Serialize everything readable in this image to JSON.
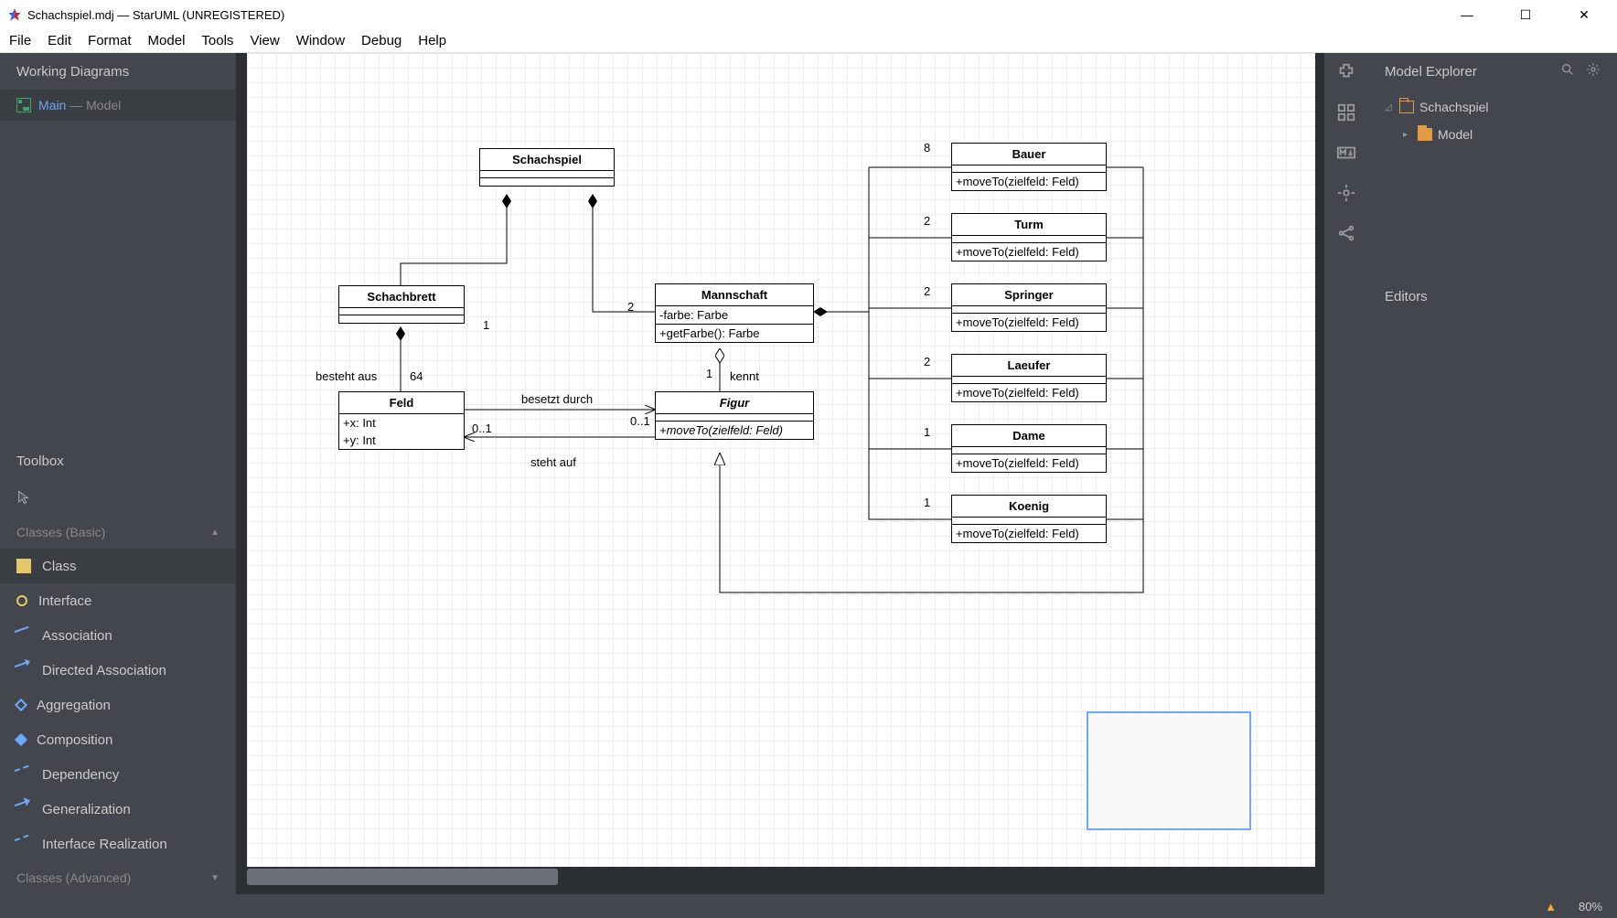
{
  "titlebar": {
    "title": "Schachspiel.mdj — StarUML (UNREGISTERED)"
  },
  "menubar": [
    "File",
    "Edit",
    "Format",
    "Model",
    "Tools",
    "View",
    "Window",
    "Debug",
    "Help"
  ],
  "left": {
    "working_header": "Working Diagrams",
    "working_item": {
      "name": "Main",
      "sep": " — ",
      "model": "Model"
    },
    "toolbox_header": "Toolbox",
    "sections": {
      "basic": "Classes (Basic)",
      "advanced": "Classes (Advanced)"
    },
    "tools": [
      "Class",
      "Interface",
      "Association",
      "Directed Association",
      "Aggregation",
      "Composition",
      "Dependency",
      "Generalization",
      "Interface Realization"
    ]
  },
  "right": {
    "explorer_header": "Model Explorer",
    "root": "Schachspiel",
    "child": "Model",
    "editors_header": "Editors"
  },
  "statusbar": {
    "zoom": "80%"
  },
  "diagram": {
    "classes": {
      "Schachspiel": {
        "name": "Schachspiel",
        "attrs": [],
        "ops": []
      },
      "Schachbrett": {
        "name": "Schachbrett",
        "attrs": [],
        "ops": []
      },
      "Mannschaft": {
        "name": "Mannschaft",
        "attrs": [
          "-farbe: Farbe"
        ],
        "ops": [
          "+getFarbe(): Farbe"
        ]
      },
      "Feld": {
        "name": "Feld",
        "attrs": [
          "+x: Int",
          "+y: Int"
        ],
        "ops": []
      },
      "Figur": {
        "name": "Figur",
        "italic": true,
        "attrs": [],
        "ops": [
          "+moveTo(zielfeld: Feld)"
        ],
        "ops_italic": true
      },
      "Bauer": {
        "name": "Bauer",
        "attrs": [],
        "ops": [
          "+moveTo(zielfeld: Feld)"
        ]
      },
      "Turm": {
        "name": "Turm",
        "attrs": [],
        "ops": [
          "+moveTo(zielfeld: Feld)"
        ]
      },
      "Springer": {
        "name": "Springer",
        "attrs": [],
        "ops": [
          "+moveTo(zielfeld: Feld)"
        ]
      },
      "Laeufer": {
        "name": "Laeufer",
        "attrs": [],
        "ops": [
          "+moveTo(zielfeld: Feld)"
        ]
      },
      "Dame": {
        "name": "Dame",
        "attrs": [],
        "ops": [
          "+moveTo(zielfeld: Feld)"
        ]
      },
      "Koenig": {
        "name": "Koenig",
        "attrs": [],
        "ops": [
          "+moveTo(zielfeld: Feld)"
        ]
      }
    },
    "labels": {
      "mult_1a": "1",
      "mult_2a": "2",
      "mult_8": "8",
      "mult_2b": "2",
      "mult_2c": "2",
      "mult_2d": "2",
      "mult_1b": "1",
      "mult_1c": "1",
      "mult_1d": "1",
      "mult_64": "64",
      "mult_01a": "0..1",
      "mult_01b": "0..1",
      "besteht_aus": "besteht aus",
      "kennt": "kennt",
      "besetzt_durch": "besetzt durch",
      "steht_auf": "steht auf"
    }
  }
}
